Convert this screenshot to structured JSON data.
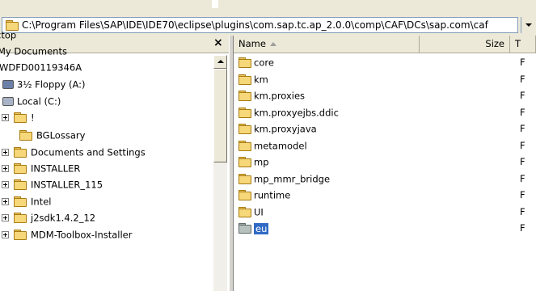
{
  "address_bar": {
    "path": "C:\\Program Files\\SAP\\IDE\\IDE70\\eclipse\\plugins\\com.sap.tc.ap_2.0.0\\comp\\CAF\\DCs\\sap.com\\caf"
  },
  "left_pane": {
    "close": "×",
    "tree": [
      {
        "label": "ctop",
        "icon": "none",
        "expander": false
      },
      {
        "label": "My Documents",
        "icon": "none",
        "expander": false
      },
      {
        "label": "WDFD00119346A",
        "icon": "none",
        "expander": false
      },
      {
        "label": "3½ Floppy (A:)",
        "icon": "floppy-icon",
        "expander": false
      },
      {
        "label": "Local (C:)",
        "icon": "drive-icon",
        "expander": false
      },
      {
        "label": "!",
        "icon": "folder-icon",
        "expander": true
      },
      {
        "label": "BGLossary",
        "icon": "folder-icon",
        "expander": false
      },
      {
        "label": "Documents and Settings",
        "icon": "folder-icon",
        "expander": true
      },
      {
        "label": "INSTALLER",
        "icon": "folder-icon",
        "expander": true
      },
      {
        "label": "INSTALLER_115",
        "icon": "folder-icon",
        "expander": true
      },
      {
        "label": "Intel",
        "icon": "folder-icon",
        "expander": true
      },
      {
        "label": "j2sdk1.4.2_12",
        "icon": "folder-icon",
        "expander": true
      },
      {
        "label": "MDM-Toolbox-Installer",
        "icon": "folder-icon",
        "expander": true
      }
    ]
  },
  "file_list": {
    "columns": {
      "name": "Name",
      "size": "Size",
      "type": "T"
    },
    "rows": [
      {
        "name": "core",
        "type": "F",
        "selected": false
      },
      {
        "name": "km",
        "type": "F",
        "selected": false
      },
      {
        "name": "km.proxies",
        "type": "F",
        "selected": false
      },
      {
        "name": "km.proxyejbs.ddic",
        "type": "F",
        "selected": false
      },
      {
        "name": "km.proxyjava",
        "type": "F",
        "selected": false
      },
      {
        "name": "metamodel",
        "type": "F",
        "selected": false
      },
      {
        "name": "mp",
        "type": "F",
        "selected": false
      },
      {
        "name": "mp_mmr_bridge",
        "type": "F",
        "selected": false
      },
      {
        "name": "runtime",
        "type": "F",
        "selected": false
      },
      {
        "name": "UI",
        "type": "F",
        "selected": false
      },
      {
        "name": "eu",
        "type": "F",
        "selected": true
      }
    ]
  },
  "colors": {
    "selection": "#316AC5",
    "folder": "#F6D77A",
    "chrome": "#ECE9D8"
  }
}
